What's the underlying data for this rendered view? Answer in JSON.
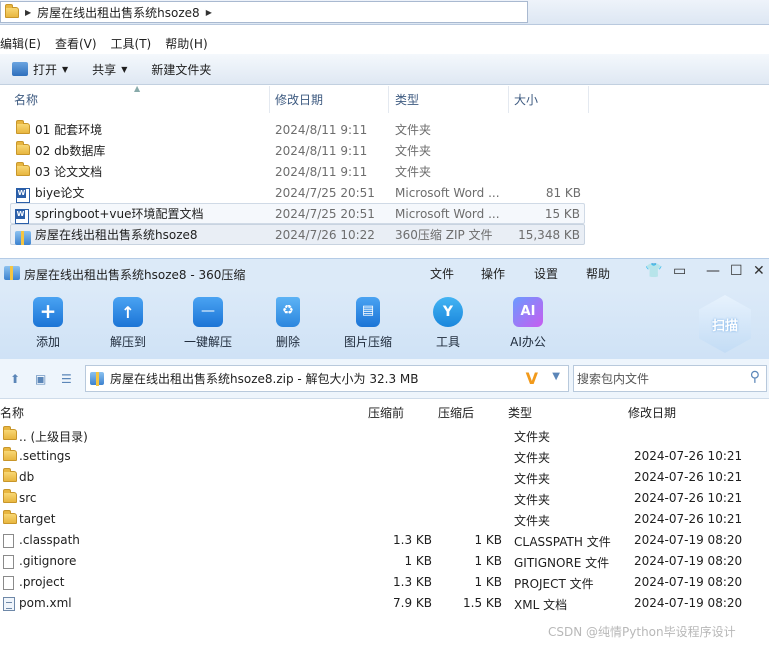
{
  "explorer": {
    "address": {
      "path": "房屋在线出租出售系统hsoze8"
    },
    "menu": [
      "编辑(E)",
      "查看(V)",
      "工具(T)",
      "帮助(H)"
    ],
    "toolbar": {
      "open": "打开",
      "share": "共享",
      "new_folder": "新建文件夹"
    },
    "columns": {
      "name": "名称",
      "date": "修改日期",
      "type": "类型",
      "size": "大小"
    },
    "rows": [
      {
        "name": "01 配套环境",
        "date": "2024/8/11 9:11",
        "type": "文件夹",
        "size": "",
        "icon": "folder-icon"
      },
      {
        "name": "02 db数据库",
        "date": "2024/8/11 9:11",
        "type": "文件夹",
        "size": "",
        "icon": "folder-icon"
      },
      {
        "name": "03 论文文档",
        "date": "2024/8/11 9:11",
        "type": "文件夹",
        "size": "",
        "icon": "folder-icon"
      },
      {
        "name": "biye论文",
        "date": "2024/7/25 20:51",
        "type": "Microsoft Word ...",
        "size": "81 KB",
        "icon": "word-icon"
      },
      {
        "name": "springboot+vue环境配置文档",
        "date": "2024/7/25 20:51",
        "type": "Microsoft Word ...",
        "size": "15 KB",
        "icon": "word-icon"
      },
      {
        "name": "房屋在线出租出售系统hsoze8",
        "date": "2024/7/26 10:22",
        "type": "360压缩 ZIP 文件",
        "size": "15,348 KB",
        "icon": "zip-icon"
      }
    ]
  },
  "zip360": {
    "title": "房屋在线出租出售系统hsoze8 - 360压缩",
    "menu": [
      "文件",
      "操作",
      "设置",
      "帮助"
    ],
    "tools": [
      "添加",
      "解压到",
      "一键解压",
      "删除",
      "图片压缩",
      "工具",
      "AI办公"
    ],
    "scan_label": "扫描",
    "path_text": "房屋在线出租出售系统hsoze8.zip - 解包大小为 32.3 MB",
    "search_placeholder": "搜索包内文件",
    "columns": {
      "name": "名称",
      "csize": "压缩前",
      "osize": "压缩后",
      "type": "类型",
      "date": "修改日期"
    },
    "rows": [
      {
        "name": ".. (上级目录)",
        "csize": "",
        "osize": "",
        "type": "文件夹",
        "date": "",
        "icon": "folder-icon"
      },
      {
        "name": ".settings",
        "csize": "",
        "osize": "",
        "type": "文件夹",
        "date": "2024-07-26 10:21",
        "icon": "folder-icon"
      },
      {
        "name": "db",
        "csize": "",
        "osize": "",
        "type": "文件夹",
        "date": "2024-07-26 10:21",
        "icon": "folder-icon"
      },
      {
        "name": "src",
        "csize": "",
        "osize": "",
        "type": "文件夹",
        "date": "2024-07-26 10:21",
        "icon": "folder-icon"
      },
      {
        "name": "target",
        "csize": "",
        "osize": "",
        "type": "文件夹",
        "date": "2024-07-26 10:21",
        "icon": "folder-icon"
      },
      {
        "name": ".classpath",
        "csize": "1.3 KB",
        "osize": "1 KB",
        "type": "CLASSPATH 文件",
        "date": "2024-07-19 08:20",
        "icon": "file-icon"
      },
      {
        "name": ".gitignore",
        "csize": "1 KB",
        "osize": "1 KB",
        "type": "GITIGNORE 文件",
        "date": "2024-07-19 08:20",
        "icon": "file-icon"
      },
      {
        "name": ".project",
        "csize": "1.3 KB",
        "osize": "1 KB",
        "type": "PROJECT 文件",
        "date": "2024-07-19 08:20",
        "icon": "file-icon"
      },
      {
        "name": "pom.xml",
        "csize": "7.9 KB",
        "osize": "1.5 KB",
        "type": "XML 文档",
        "date": "2024-07-19 08:20",
        "icon": "xml-icon"
      }
    ]
  },
  "watermark": "CSDN @纯情Python毕设程序设计"
}
